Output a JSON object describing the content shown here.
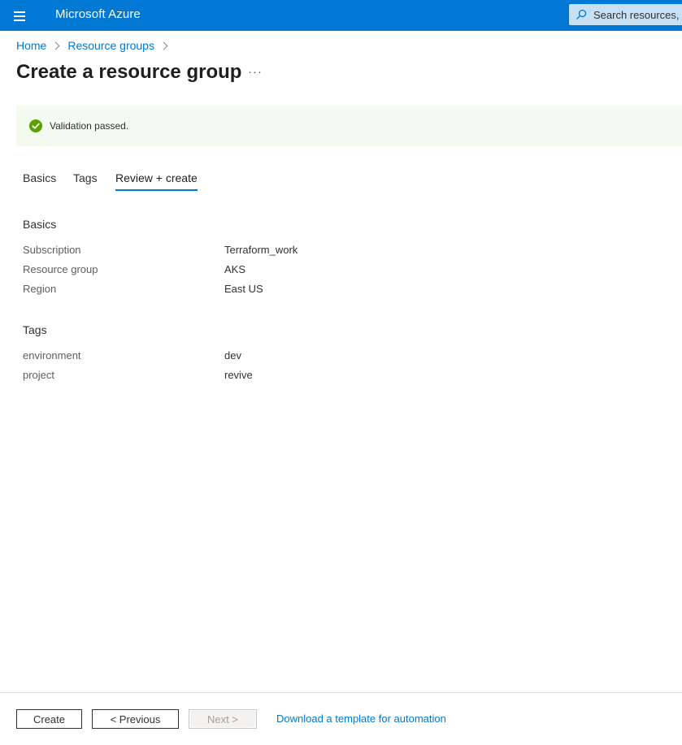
{
  "header": {
    "brand": "Microsoft Azure",
    "search_placeholder": "Search resources, s",
    "accent_color": "#0078d4"
  },
  "breadcrumb": [
    "Home",
    "Resource groups"
  ],
  "page": {
    "title": "Create a resource group",
    "more_label": "···"
  },
  "validation": {
    "text": "Validation passed.",
    "status_color": "#57a300"
  },
  "tabs": [
    {
      "label": "Basics",
      "active": false
    },
    {
      "label": "Tags",
      "active": false
    },
    {
      "label": "Review + create",
      "active": true
    }
  ],
  "basics": {
    "title": "Basics",
    "rows": [
      {
        "label": "Subscription",
        "value": "Terraform_work"
      },
      {
        "label": "Resource group",
        "value": "AKS"
      },
      {
        "label": "Region",
        "value": "East US"
      }
    ]
  },
  "tags": {
    "title": "Tags",
    "rows": [
      {
        "label": "environment",
        "value": "dev"
      },
      {
        "label": "project",
        "value": "revive"
      }
    ]
  },
  "footer": {
    "create_label": "Create",
    "previous_label": "< Previous",
    "next_label": "Next >",
    "download_label": "Download a template for automation"
  }
}
